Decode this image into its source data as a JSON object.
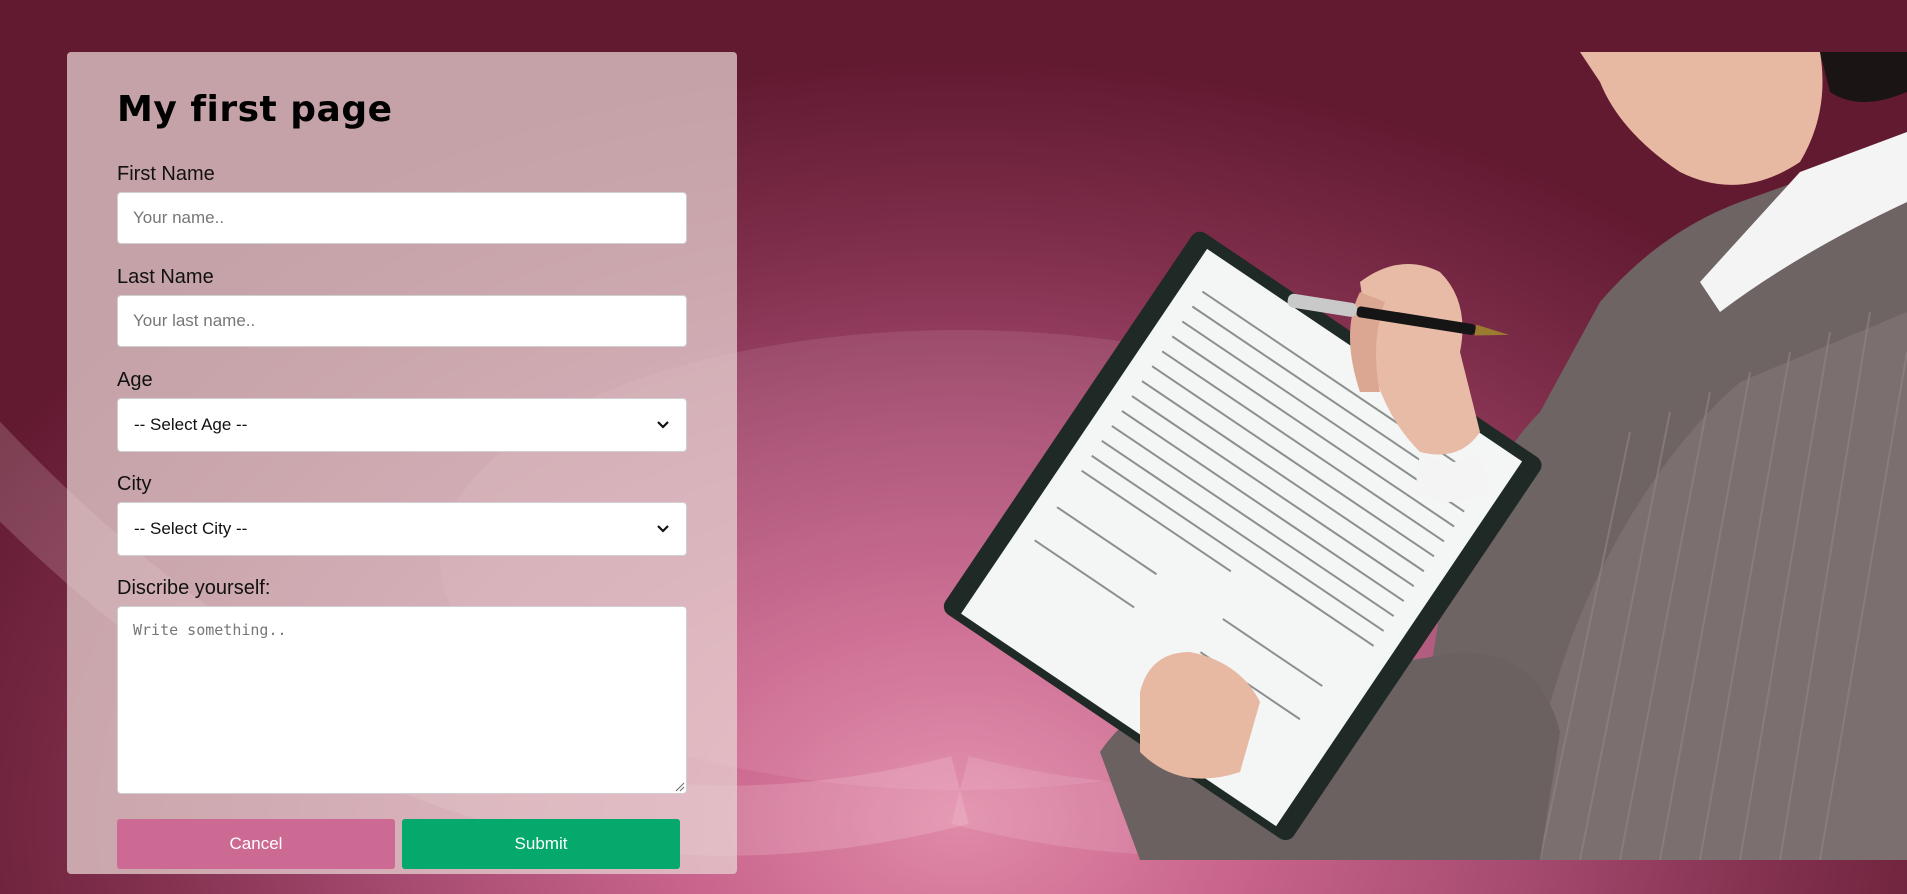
{
  "form": {
    "title": "My first page",
    "first_name": {
      "label": "First Name",
      "placeholder": "Your name.."
    },
    "last_name": {
      "label": "Last Name",
      "placeholder": "Your last name.."
    },
    "age": {
      "label": "Age",
      "selected": "-- Select Age --"
    },
    "city": {
      "label": "City",
      "selected": "-- Select City --"
    },
    "describe": {
      "label": "Discribe yourself:",
      "placeholder": "Write something.."
    },
    "cancel_label": "Cancel",
    "submit_label": "Submit"
  },
  "colors": {
    "background": "#a54a70",
    "cancel_button": "#cd6a93",
    "submit_button": "#04a96b"
  }
}
